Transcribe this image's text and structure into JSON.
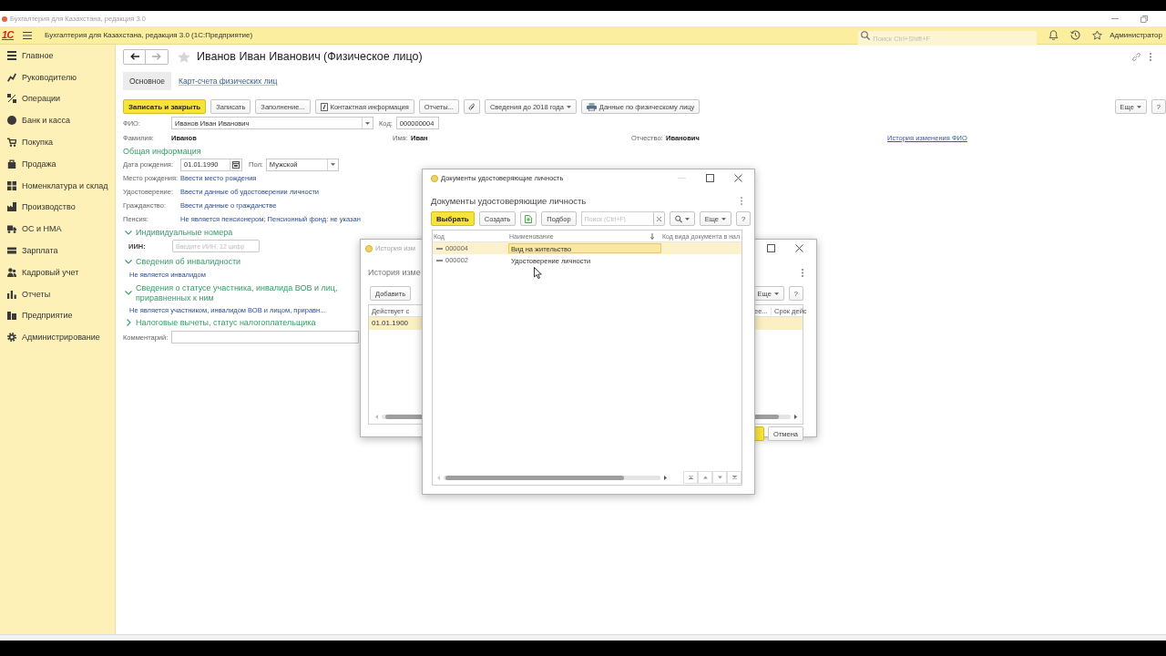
{
  "window": {
    "title": "Бухгалтерия для Казахстана, редакция 3.0"
  },
  "header": {
    "logo": "1С",
    "title": "Бухгалтерия для Казахстана, редакция 3.0 (1С:Предприятие)",
    "search": {
      "placeholder": "Поиск Ctrl+Shift+F"
    },
    "user": "Администратор"
  },
  "sidebar": {
    "items": [
      {
        "label": "Главное",
        "selected": false
      },
      {
        "label": "Руководителю",
        "selected": false
      },
      {
        "label": "Операции",
        "selected": false
      },
      {
        "label": "Банк и касса",
        "selected": false
      },
      {
        "label": "Покупка",
        "selected": false
      },
      {
        "label": "Продажа",
        "selected": false
      },
      {
        "label": "Номенклатура и склад",
        "selected": false
      },
      {
        "label": "Производство",
        "selected": false
      },
      {
        "label": "ОС и НМА",
        "selected": false
      },
      {
        "label": "Зарплата",
        "selected": false
      },
      {
        "label": "Кадровый учет",
        "selected": false
      },
      {
        "label": "Отчеты",
        "selected": false
      },
      {
        "label": "Предприятие",
        "selected": false
      },
      {
        "label": "Администрирование",
        "selected": false
      }
    ]
  },
  "form": {
    "title": "Иванов Иван Иванович (Физическое лицо)",
    "starred": false,
    "tabs": [
      {
        "label": "Основное",
        "selected": true
      },
      {
        "label": "Карт-счета физических лиц",
        "selected": false
      }
    ],
    "toolbar": [
      {
        "label": "Записать и закрыть",
        "kind": "primary"
      },
      {
        "label": "Записать",
        "kind": "plain"
      },
      {
        "label": "Заполнение...",
        "kind": "plain"
      },
      {
        "label": "Контактная информация",
        "kind": "contact"
      },
      {
        "label": "Отчеты...",
        "kind": "plain"
      },
      {
        "kind": "attach"
      },
      {
        "label": "Сведения до 2018 года",
        "kind": "dropdown"
      },
      {
        "label": "Данные по физическому лицу",
        "kind": "print"
      }
    ],
    "toolbar_right": [
      {
        "label": "Еще",
        "kind": "dropdown"
      },
      {
        "label": "?",
        "kind": "plain"
      }
    ],
    "fio": {
      "label": "ФИО:",
      "value": "Иванов Иван Иванович"
    },
    "code": {
      "label": "Код:",
      "value": "000000004"
    },
    "name_parts": [
      {
        "label": "Фамилия:",
        "value": "Иванов"
      },
      {
        "label": "Имя:",
        "value": "Иван"
      },
      {
        "label": "Отчество:",
        "value": "Иванович"
      }
    ],
    "history_link": "История изменения ФИО",
    "general": {
      "title": "Общая информация",
      "birth_date": {
        "label": "Дата рождения:",
        "value": "01.01.1990"
      },
      "gender": {
        "label": "Пол:",
        "value": "Мужской"
      },
      "links": [
        {
          "label": "Место рождения:",
          "value": "Ввести место рождения"
        },
        {
          "label": "Удостоверение:",
          "value": "Ввести данные об удостоверении личности"
        },
        {
          "label": "Гражданство:",
          "value": "Ввести данные о гражданстве"
        },
        {
          "label": "Пенсия:",
          "value": "Не является пенсионером; Пенсионный фонд: не указан"
        }
      ]
    },
    "groups": [
      {
        "title": "Индивидуальные номера",
        "expanded": true,
        "field": {
          "label": "ИИН:",
          "placeholder": "Введите ИИН, 12 цифр"
        }
      },
      {
        "title": "Сведения об инвалидности",
        "expanded": true,
        "text": "Не является инвалидом"
      },
      {
        "title": "Сведения о статусе участника, инвалида ВОВ и лиц, приравненных к ним",
        "expanded": true,
        "text": "Не является участником, инвалидом ВОВ и лицом, приравн..."
      },
      {
        "title": "Налоговые вычеты, статус налогоплательщика",
        "expanded": false
      }
    ],
    "comment": {
      "label": "Комментарий:"
    }
  },
  "history_dialog": {
    "title": "История изм",
    "heading": "История изме",
    "toolbar_left": [
      {
        "label": "Добавить",
        "kind": "plain"
      }
    ],
    "toolbar_right": [
      {
        "label": "Еще",
        "kind": "dropdown"
      },
      {
        "label": "?",
        "kind": "plain"
      }
    ],
    "columns": [
      {
        "label": "Действует с"
      },
      {
        "label": "ее..."
      },
      {
        "label": "Срок дейс"
      }
    ],
    "rows": [
      {
        "cells": [
          "01.01.1900"
        ],
        "selected": true
      }
    ],
    "cancel_button": "Отмена"
  },
  "documents_dialog": {
    "title": "Документы удостоверяющие личность",
    "heading": "Документы удостоверяющие личность",
    "toolbar": [
      {
        "label": "Выбрать",
        "kind": "primary"
      },
      {
        "label": "Создать",
        "kind": "plain"
      },
      {
        "kind": "copy"
      },
      {
        "label": "Подбор",
        "kind": "plain"
      },
      {
        "kind": "search",
        "placeholder": "Поиск (Ctrl+F)"
      },
      {
        "kind": "find"
      },
      {
        "label": "Еще",
        "kind": "dropdown"
      },
      {
        "label": "?",
        "kind": "plain"
      }
    ],
    "columns": [
      "Код",
      "Наименование",
      "Код вида документа в нал"
    ],
    "rows": [
      {
        "code": "000004",
        "name": "Вид на жительство",
        "selected": true
      },
      {
        "code": "000002",
        "name": "Удостоверение личности",
        "selected": false
      }
    ]
  }
}
